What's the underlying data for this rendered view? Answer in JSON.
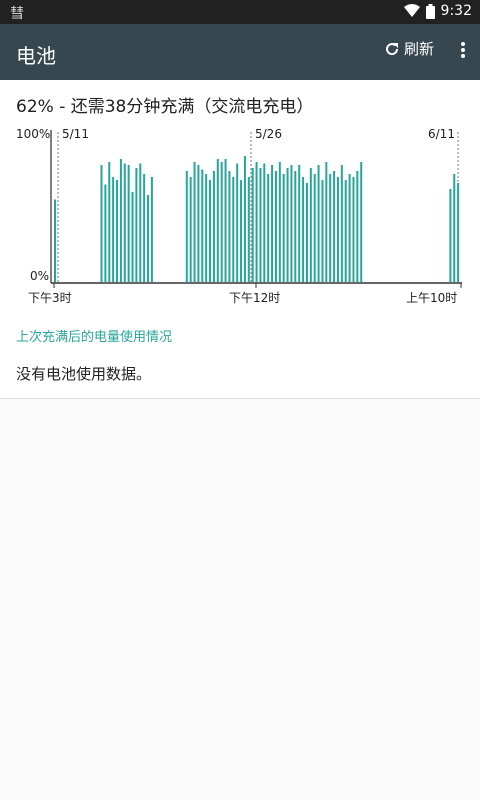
{
  "status_bar": {
    "left_glyph": "彗",
    "time": "9:32"
  },
  "app_bar": {
    "title": "电池",
    "refresh_label": "刷新"
  },
  "summary": {
    "headline": "62% - 还需38分钟充满（交流电充电）"
  },
  "chart_data": {
    "type": "bar",
    "y_tick_labels": [
      "100%",
      "0%"
    ],
    "x_tick_labels": [
      "下午3时",
      "下午12时",
      "上午10时"
    ],
    "date_markers": [
      "5/11",
      "5/26",
      "6/11"
    ],
    "ylim": [
      0,
      100
    ],
    "bar_color": "#26a69a",
    "values": [
      55,
      0,
      0,
      0,
      0,
      0,
      0,
      0,
      0,
      0,
      0,
      0,
      78,
      65,
      80,
      70,
      68,
      82,
      79,
      78,
      60,
      76,
      79,
      72,
      58,
      70,
      0,
      0,
      0,
      0,
      0,
      0,
      0,
      0,
      74,
      70,
      80,
      78,
      75,
      72,
      68,
      74,
      82,
      80,
      82,
      74,
      70,
      79,
      68,
      84,
      70,
      76,
      80,
      76,
      79,
      72,
      78,
      74,
      80,
      72,
      76,
      78,
      74,
      78,
      70,
      66,
      76,
      72,
      78,
      68,
      80,
      72,
      74,
      70,
      78,
      68,
      72,
      70,
      74,
      80,
      0,
      0,
      0,
      0,
      0,
      0,
      0,
      0,
      0,
      0,
      0,
      0,
      0,
      0,
      0,
      0,
      0,
      0,
      0,
      0,
      0,
      0,
      62,
      72,
      66
    ]
  },
  "usage_section": {
    "title": "上次充满后的电量使用情况",
    "empty_message": "没有电池使用数据。"
  }
}
